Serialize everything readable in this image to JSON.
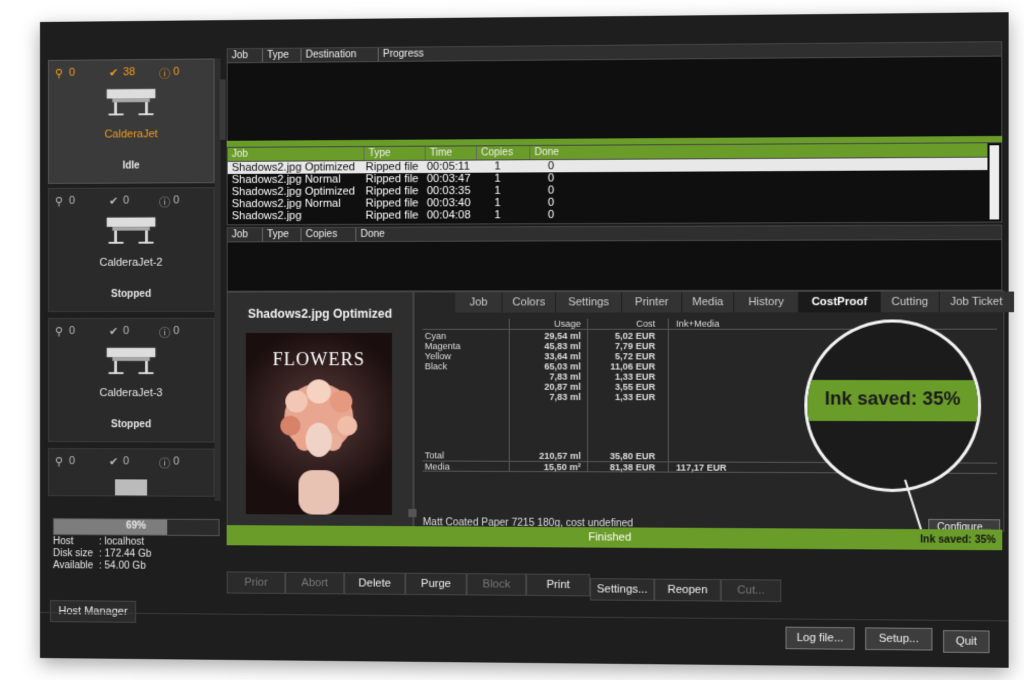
{
  "printers": [
    {
      "alerts": "0",
      "done": "38",
      "errors": "0",
      "name": "CalderaJet",
      "state": "Idle",
      "active": true
    },
    {
      "alerts": "0",
      "done": "0",
      "errors": "0",
      "name": "CalderaJet-2",
      "state": "Stopped",
      "active": false
    },
    {
      "alerts": "0",
      "done": "0",
      "errors": "0",
      "name": "CalderaJet-3",
      "state": "Stopped",
      "active": false
    },
    {
      "alerts": "0",
      "done": "0",
      "errors": "0",
      "name": "",
      "state": "",
      "active": false
    }
  ],
  "host": {
    "disk_progress": "69%",
    "progress_value": 0.69,
    "host_label": "Host",
    "host_value": "localhost",
    "disk_label": "Disk size",
    "disk_value": "172.44 Gb",
    "avail_label": "Available",
    "avail_value": "54.00 Gb",
    "manager_button": "Host Manager"
  },
  "queue_table": {
    "headers": [
      "Job",
      "Type",
      "Destination",
      "Progress"
    ]
  },
  "ripped_table": {
    "headers": [
      "Job",
      "Type",
      "Time",
      "Copies",
      "Done"
    ],
    "rows": [
      [
        "Shadows2.jpg Optimized",
        "Ripped file",
        "00:05:11",
        "1",
        "0"
      ],
      [
        "Shadows2.jpg Normal",
        "Ripped file",
        "00:03:47",
        "1",
        "0"
      ],
      [
        "Shadows2.jpg Optimized",
        "Ripped file",
        "00:03:35",
        "1",
        "0"
      ],
      [
        "Shadows2.jpg Normal",
        "Ripped file",
        "00:03:40",
        "1",
        "0"
      ],
      [
        "Shadows2.jpg",
        "Ripped file",
        "00:04:08",
        "1",
        "0"
      ]
    ]
  },
  "print_table": {
    "headers": [
      "Job",
      "Type",
      "Copies",
      "Done"
    ]
  },
  "preview": {
    "title": "Shadows2.jpg Optimized",
    "poster_text": "FLOWERS"
  },
  "tabs": [
    "Job",
    "Colors",
    "Settings",
    "Printer",
    "Media",
    "History",
    "CostProof",
    "Cutting",
    "Job Ticket"
  ],
  "active_tab": "CostProof",
  "costproof": {
    "headers": [
      "Usage",
      "Cost",
      "Ink+Media"
    ],
    "ink_names": [
      "Cyan",
      "Magenta",
      "Yellow",
      "Black"
    ],
    "usage": [
      "29,54 ml",
      "45,83 ml",
      "33,64 ml",
      "65,03 ml",
      "7,83 ml",
      "20,87 ml",
      "7,83 ml"
    ],
    "cost": [
      "5,02 EUR",
      "7,79 EUR",
      "5,72 EUR",
      "11,06 EUR",
      "1,33 EUR",
      "3,55 EUR",
      "1,33 EUR"
    ],
    "total_label": "Total",
    "total_usage": "210,57 ml",
    "total_cost": "35,80 EUR",
    "media_label": "Media",
    "media_usage": "15,50 m²",
    "media_cost": "81,38 EUR",
    "ink_media_total": "117,17 EUR",
    "media_note": "Matt Coated Paper 7215 180g, cost undefined",
    "configure_button": "Configure..."
  },
  "callout_text": "Ink saved: 35%",
  "status_bar": {
    "center": "Finished",
    "right": "Ink saved: 35%"
  },
  "action_buttons": [
    {
      "label": "Prior",
      "dim": true
    },
    {
      "label": "Abort",
      "dim": true
    },
    {
      "label": "Delete",
      "dim": false
    },
    {
      "label": "Purge",
      "dim": false
    },
    {
      "label": "Block",
      "dim": true
    },
    {
      "label": "Print",
      "dim": false
    },
    {
      "label": "Settings...",
      "dim": false
    },
    {
      "label": "Reopen",
      "dim": false
    },
    {
      "label": "Cut...",
      "dim": true
    }
  ],
  "footer_buttons": [
    "Log file...",
    "Setup...",
    "Quit"
  ],
  "colors": {
    "accent_green": "#6a9c2a",
    "orange": "#f39a1c"
  }
}
